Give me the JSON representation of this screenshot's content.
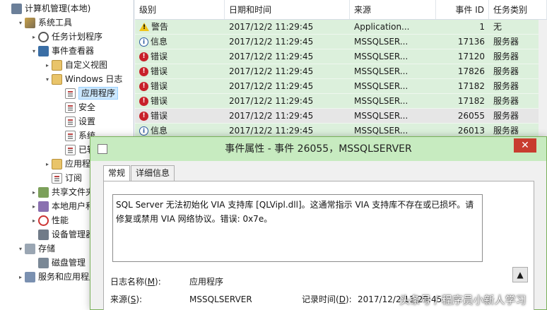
{
  "tree": [
    {
      "label": "计算机管理(本地)",
      "indent": 0,
      "arrow": "",
      "icon": "root"
    },
    {
      "label": "系统工具",
      "indent": 1,
      "arrow": "▾",
      "icon": "tools"
    },
    {
      "label": "任务计划程序",
      "indent": 2,
      "arrow": "▸",
      "icon": "clock"
    },
    {
      "label": "事件查看器",
      "indent": 2,
      "arrow": "▾",
      "icon": "ev"
    },
    {
      "label": "自定义视图",
      "indent": 3,
      "arrow": "▸",
      "icon": "folder"
    },
    {
      "label": "Windows 日志",
      "indent": 3,
      "arrow": "▾",
      "icon": "folder"
    },
    {
      "label": "应用程序",
      "indent": 4,
      "arrow": "",
      "icon": "log",
      "selected": true
    },
    {
      "label": "安全",
      "indent": 4,
      "arrow": "",
      "icon": "log"
    },
    {
      "label": "设置",
      "indent": 4,
      "arrow": "",
      "icon": "log"
    },
    {
      "label": "系统",
      "indent": 4,
      "arrow": "",
      "icon": "log"
    },
    {
      "label": "已转发",
      "indent": 4,
      "arrow": "",
      "icon": "log"
    },
    {
      "label": "应用程序",
      "indent": 3,
      "arrow": "▸",
      "icon": "folder"
    },
    {
      "label": "订阅",
      "indent": 3,
      "arrow": "",
      "icon": "log"
    },
    {
      "label": "共享文件夹",
      "indent": 2,
      "arrow": "▸",
      "icon": "share"
    },
    {
      "label": "本地用户和组",
      "indent": 2,
      "arrow": "▸",
      "icon": "users"
    },
    {
      "label": "性能",
      "indent": 2,
      "arrow": "▸",
      "icon": "perf"
    },
    {
      "label": "设备管理器",
      "indent": 2,
      "arrow": "",
      "icon": "dev"
    },
    {
      "label": "存储",
      "indent": 1,
      "arrow": "▾",
      "icon": "storage"
    },
    {
      "label": "磁盘管理",
      "indent": 2,
      "arrow": "",
      "icon": "disk"
    },
    {
      "label": "服务和应用程序",
      "indent": 1,
      "arrow": "▸",
      "icon": "svc"
    }
  ],
  "table": {
    "headers": [
      "级别",
      "日期和时间",
      "来源",
      "事件 ID",
      "任务类别"
    ],
    "rows": [
      {
        "level": "警告",
        "kind": "warn",
        "datetime": "2017/12/2 11:29:45",
        "source": "Application...",
        "id": "1",
        "category": "无"
      },
      {
        "level": "信息",
        "kind": "info",
        "datetime": "2017/12/2 11:29:45",
        "source": "MSSQLSER...",
        "id": "17136",
        "category": "服务器"
      },
      {
        "level": "错误",
        "kind": "err",
        "datetime": "2017/12/2 11:29:45",
        "source": "MSSQLSER...",
        "id": "17120",
        "category": "服务器"
      },
      {
        "level": "错误",
        "kind": "err",
        "datetime": "2017/12/2 11:29:45",
        "source": "MSSQLSER...",
        "id": "17826",
        "category": "服务器"
      },
      {
        "level": "错误",
        "kind": "err",
        "datetime": "2017/12/2 11:29:45",
        "source": "MSSQLSER...",
        "id": "17182",
        "category": "服务器"
      },
      {
        "level": "错误",
        "kind": "err",
        "datetime": "2017/12/2 11:29:45",
        "source": "MSSQLSER...",
        "id": "17182",
        "category": "服务器"
      },
      {
        "level": "错误",
        "kind": "err",
        "datetime": "2017/12/2 11:29:45",
        "source": "MSSQLSER...",
        "id": "26055",
        "category": "服务器",
        "selected": true
      },
      {
        "level": "信息",
        "kind": "info",
        "datetime": "2017/12/2 11:29:45",
        "source": "MSSQLSER...",
        "id": "26013",
        "category": "服务器"
      }
    ]
  },
  "dialog": {
    "title": "事件属性 - 事件 26055，MSSQLSERVER",
    "close": "✕",
    "tabs": [
      "常规",
      "详细信息"
    ],
    "description": "SQL Server 无法初始化 VIA 支持库 [QLVipl.dll]。这通常指示 VIA 支持库不存在或已损坏。请修复或禁用 VIA 网络协议。错误: 0x7e。",
    "log_name_label": "日志名称(",
    "log_name_key": "M",
    "log_name_value": "应用程序",
    "source_label": "来源(",
    "source_key": "S",
    "source_value": "MSSQLSERVER",
    "logged_label": "记录时间(",
    "logged_key": "D",
    "logged_value": "2017/12/2 11:29:45",
    "scroll_up": "▲"
  },
  "watermark": "头条号 / 程序员小新人学习"
}
